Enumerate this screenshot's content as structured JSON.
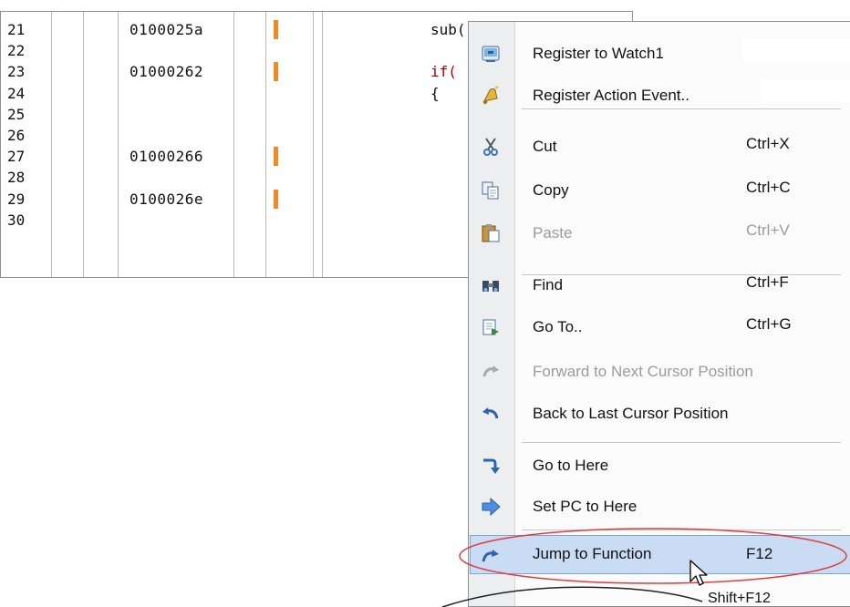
{
  "editor": {
    "rows": [
      {
        "line": "21",
        "address": "0100025a",
        "marked": true,
        "code": "sub(-1);"
      },
      {
        "line": "22",
        "address": "",
        "marked": false,
        "code": ""
      },
      {
        "line": "23",
        "address": "01000262",
        "marked": true,
        "code": "if(",
        "code_is_keyword": true
      },
      {
        "line": "24",
        "address": "",
        "marked": false,
        "code": "{"
      },
      {
        "line": "25",
        "address": "",
        "marked": false,
        "code": ""
      },
      {
        "line": "26",
        "address": "",
        "marked": false,
        "code": ""
      },
      {
        "line": "27",
        "address": "01000266",
        "marked": true,
        "code": ""
      },
      {
        "line": "28",
        "address": "",
        "marked": false,
        "code": ""
      },
      {
        "line": "29",
        "address": "0100026e",
        "marked": true,
        "code": ""
      },
      {
        "line": "30",
        "address": "",
        "marked": false,
        "code": ""
      }
    ],
    "marker_color": "#f08a24"
  },
  "context_menu": {
    "items": [
      {
        "id": "register-to-watch1",
        "label": "Register to Watch1",
        "shortcut": "",
        "icon": "watch-register-icon",
        "enabled": true
      },
      {
        "id": "register-action-event",
        "label": "Register Action Event..",
        "shortcut": "",
        "icon": "bell-action-event-icon",
        "enabled": true
      },
      {
        "id": "cut",
        "label": "Cut",
        "shortcut": "Ctrl+X",
        "icon": "scissors-icon",
        "enabled": true
      },
      {
        "id": "copy",
        "label": "Copy",
        "shortcut": "Ctrl+C",
        "icon": "copy-icon",
        "enabled": true
      },
      {
        "id": "paste",
        "label": "Paste",
        "shortcut": "Ctrl+V",
        "icon": "paste-icon",
        "enabled": false
      },
      {
        "id": "find",
        "label": "Find",
        "shortcut": "Ctrl+F",
        "icon": "binoculars-icon",
        "enabled": true
      },
      {
        "id": "go-to",
        "label": "Go To..",
        "shortcut": "Ctrl+G",
        "icon": "go-to-icon",
        "enabled": true
      },
      {
        "id": "forward-cursor",
        "label": "Forward to Next Cursor Position",
        "shortcut": "",
        "icon": "forward-arrow-icon",
        "enabled": false
      },
      {
        "id": "back-cursor",
        "label": "Back to Last Cursor Position",
        "shortcut": "",
        "icon": "back-arrow-icon",
        "enabled": true
      },
      {
        "id": "go-to-here",
        "label": "Go to Here",
        "shortcut": "",
        "icon": "go-here-arrow-icon",
        "enabled": true
      },
      {
        "id": "set-pc",
        "label": "Set PC to Here",
        "shortcut": "",
        "icon": "set-pc-arrow-icon",
        "enabled": true
      },
      {
        "id": "jump-to-function",
        "label": "Jump to Function",
        "shortcut": "F12",
        "icon": "jump-arrow-icon",
        "enabled": true,
        "highlighted": true
      }
    ],
    "tooltip_shortcut": "Shift+F12"
  },
  "colors": {
    "highlight": "#c9dcf3",
    "highlight_border": "#7aa5d8",
    "annotation_ellipse": "#e03a3a",
    "disabled_text": "#9b9b9b"
  }
}
